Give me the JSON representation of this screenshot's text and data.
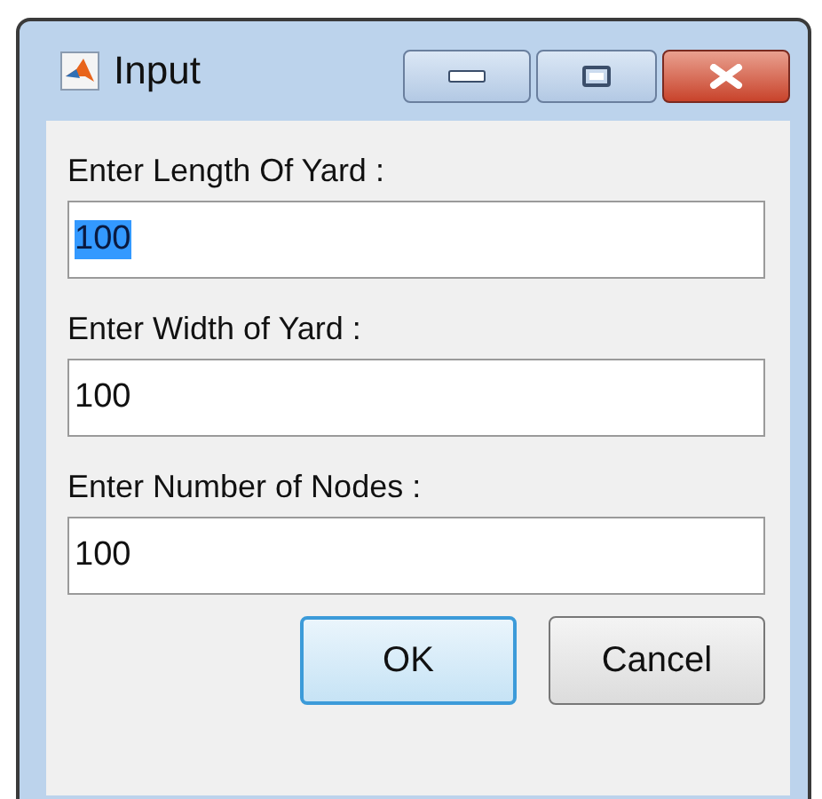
{
  "window": {
    "title": "Input"
  },
  "fields": [
    {
      "label": "Enter Length Of Yard :",
      "value": "100",
      "selected": true
    },
    {
      "label": "Enter Width of Yard :",
      "value": "100",
      "selected": false
    },
    {
      "label": "Enter Number of Nodes :",
      "value": "100",
      "selected": false
    }
  ],
  "buttons": [
    {
      "label": "OK",
      "default": true
    },
    {
      "label": "Cancel",
      "default": false
    }
  ]
}
